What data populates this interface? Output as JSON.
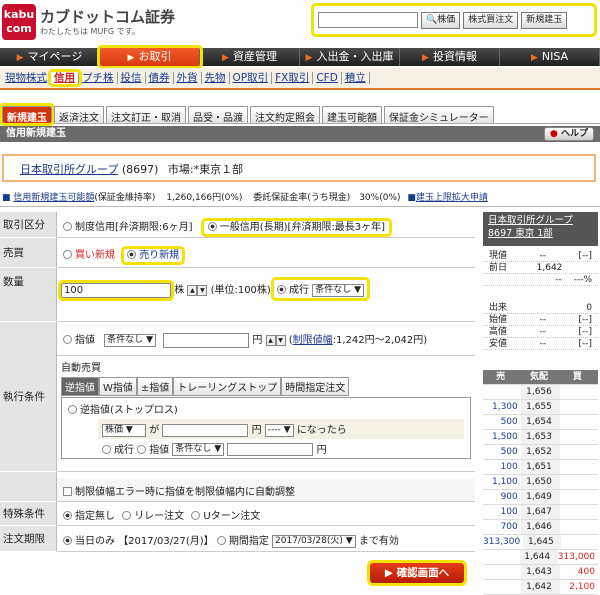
{
  "header": {
    "logo_text": "kabu com",
    "brand": "カブドットコム証券",
    "tagline": "わたしたちは MUFG です。",
    "search_placeholder": "",
    "btn_stock": "株価",
    "btn_cross": "株式買注文",
    "btn_new": "新規建玉"
  },
  "main_nav": [
    "マイページ",
    "お取引",
    "資産管理",
    "入出金・入出庫",
    "投資情報",
    "NISA"
  ],
  "sub_nav": [
    "現物株式",
    "信用",
    "プチ株",
    "投信",
    "債券",
    "外貨",
    "先物",
    "OP取引",
    "FX取引",
    "CFD",
    "積立"
  ],
  "tabs": [
    "新規建玉",
    "返済注文",
    "注文訂正・取消",
    "品受・品渡",
    "注文約定照会",
    "建玉可能額",
    "保証金シミュレーター"
  ],
  "title": "信用新規建玉",
  "help": "ヘルプ",
  "stock": {
    "name": "日本取引所グループ",
    "code": "(8697)",
    "market": "市場:*東京１部"
  },
  "margin": {
    "link": "信用新規建玉可能額",
    "ratio_label": "(保証金維持率)",
    "amount": "1,260,166円(0%)",
    "deposit_label": "委託保証金率(うち現金)",
    "deposit": "30%(0%)",
    "limit_link": "建玉上限拡大申請"
  },
  "form": {
    "kubun_label": "取引区分",
    "kubun_opt1": "制度信用[弁済期限:6ヶ月]",
    "kubun_opt2": "一般信用(長期)[弁済期限:最長3ヶ年]",
    "baibai_label": "売買",
    "buy": "買い新規",
    "sell": "売り新規",
    "qty_label": "数量",
    "qty_value": "100",
    "qty_unit": "株",
    "qty_note": "(単位:100株)",
    "nari": "成行",
    "nari_cond": "条件なし",
    "shitei": "指値",
    "shitei_cond": "条件なし",
    "yen": "円",
    "limit_link": "制限値幅",
    "limit_range": ":1,242円〜2,042円)",
    "exec_label": "執行条件",
    "auto": "自動売買",
    "exec_tabs": [
      "逆指値",
      "W指値",
      "±指値",
      "トレーリングストップ",
      "時間指定注文"
    ],
    "stop": "逆指値(ストップロス)",
    "stop_src": "株価",
    "stop_cmp": "が",
    "stop_dir": "----",
    "stop_suffix": "になったら",
    "stop_nari": "成行",
    "stop_shitei": "指値",
    "stop_cond": "条件なし",
    "auto_adjust": "制限値幅エラー時に指値を制限値幅内に自動調整",
    "special_label": "特殊条件",
    "sp1": "指定無し",
    "sp2": "リレー注文",
    "sp3": "Uターン注文",
    "deadline_label": "注文期限",
    "today": "当日のみ",
    "today_date": "【2017/03/27(月)】",
    "period": "期間指定",
    "period_date": "2017/03/28(火)",
    "period_suffix": "まで有効"
  },
  "confirm": "確認画面へ",
  "quote": {
    "name": "日本取引所グループ",
    "sub": "8697 東京 1部",
    "rows": [
      [
        "現値",
        "--",
        "[--]"
      ],
      [
        "前日",
        "1,642",
        ""
      ],
      [
        "",
        "--",
        "---%"
      ]
    ],
    "rows2": [
      [
        "出来",
        "",
        "0"
      ],
      [
        "始値",
        "--",
        "[--]"
      ],
      [
        "高値",
        "--",
        "[--]"
      ],
      [
        "安値",
        "--",
        "[--]"
      ]
    ]
  },
  "board": {
    "head": [
      "売",
      "気配",
      "買"
    ],
    "rows": [
      [
        "",
        "1,656",
        ""
      ],
      [
        "1,300",
        "1,655",
        ""
      ],
      [
        "500",
        "1,654",
        ""
      ],
      [
        "1,500",
        "1,653",
        ""
      ],
      [
        "500",
        "1,652",
        ""
      ],
      [
        "100",
        "1,651",
        ""
      ],
      [
        "1,100",
        "1,650",
        ""
      ],
      [
        "900",
        "1,649",
        ""
      ],
      [
        "100",
        "1,647",
        ""
      ],
      [
        "700",
        "1,646",
        ""
      ],
      [
        "313,300",
        "1,645",
        ""
      ],
      [
        "",
        "1,644",
        "313,000"
      ],
      [
        "",
        "1,643",
        "400"
      ],
      [
        "",
        "1,642",
        "2,100"
      ]
    ]
  },
  "colors": {
    "accent": "#d3340e",
    "highlight": "#f2e205"
  }
}
